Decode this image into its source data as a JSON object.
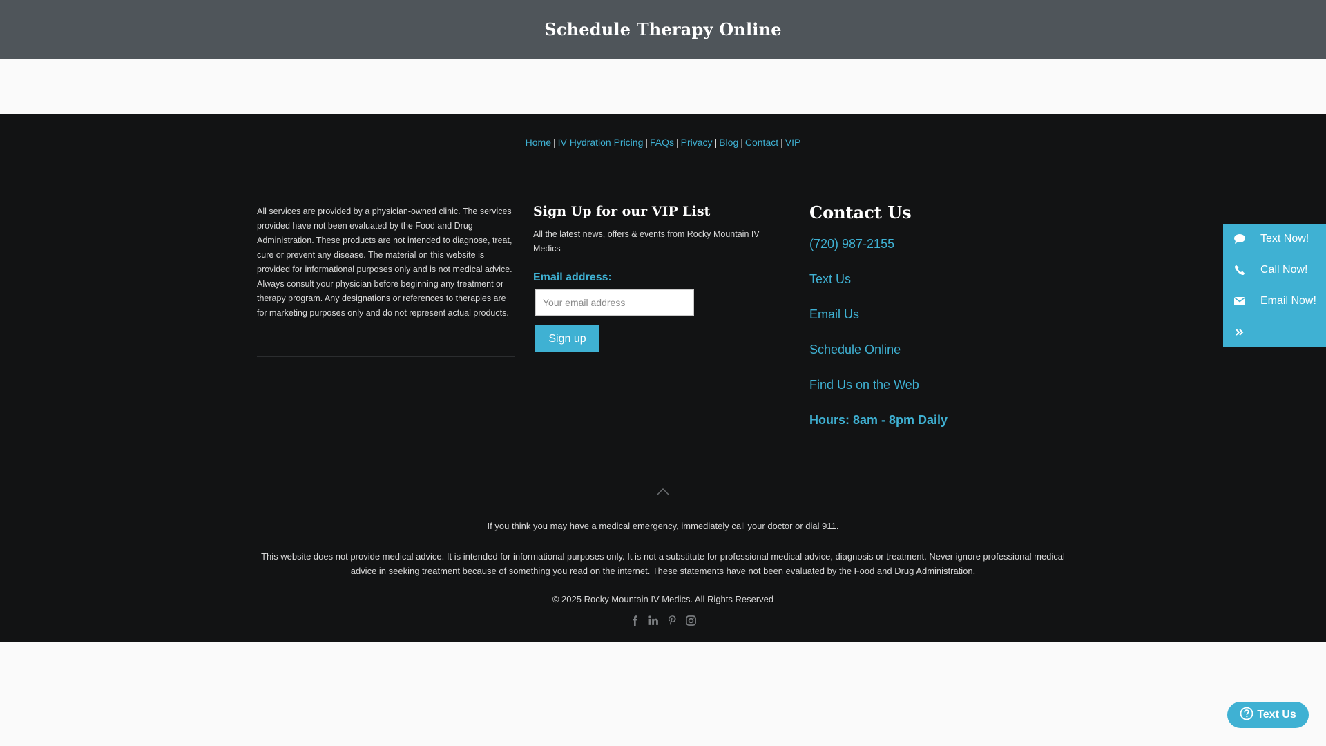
{
  "header": {
    "title": "Schedule Therapy Online"
  },
  "footer_nav": {
    "items": [
      {
        "label": "Home"
      },
      {
        "label": "IV Hydration Pricing"
      },
      {
        "label": "FAQs"
      },
      {
        "label": "Privacy"
      },
      {
        "label": "Blog"
      },
      {
        "label": "Contact"
      },
      {
        "label": "VIP"
      }
    ],
    "separator": "|"
  },
  "disclaimer_column": {
    "text": "All services are provided by a physician-owned clinic. The services provided have not been evaluated by the Food and Drug Administration. These products are not intended to diagnose, treat, cure or prevent any disease. The material on this website is provided for informational purposes only and is not medical advice. Always consult your physician before beginning any treatment or therapy program. Any designations or references to therapies are for marketing purposes only and do not represent actual products."
  },
  "vip_signup": {
    "heading": "Sign Up for our VIP List",
    "description": "All the latest news, offers & events from Rocky Mountain IV Medics",
    "email_label": "Email address:",
    "email_placeholder": "Your email address",
    "email_value": "",
    "button_label": "Sign up"
  },
  "contact": {
    "heading": "Contact Us",
    "phone": "(720) 987-2155",
    "text_us": "Text Us",
    "email_us": "Email Us",
    "schedule_online": "Schedule Online",
    "find_us": "Find Us on the Web",
    "hours": "Hours: 8am - 8pm Daily"
  },
  "bottom": {
    "emergency": "If you think you may have a medical emergency, immediately call your doctor or dial 911.",
    "disclaimer": "This website does not provide medical advice. It is intended for informational purposes only. It is not a substitute for professional medical advice, diagnosis or treatment. Never ignore professional medical advice in seeking treatment because of something you read on the internet. These statements have not been evaluated by the Food and Drug Administration.",
    "copyright": "© 2025 Rocky Mountain IV Medics. All Rights Reserved",
    "social_icons": [
      "facebook-icon",
      "linkedin-icon",
      "pinterest-icon",
      "instagram-icon"
    ]
  },
  "side_panel": {
    "items": [
      {
        "label": "Text Now!",
        "icon": "chat-bubble-icon"
      },
      {
        "label": "Call Now!",
        "icon": "phone-icon"
      },
      {
        "label": "Email Now!",
        "icon": "envelope-icon"
      }
    ],
    "collapse_icon": "double-chevron-right-icon"
  },
  "chat_button": {
    "label": "Text Us",
    "icon": "question-circle-icon"
  },
  "colors": {
    "accent": "#3fb1d3",
    "header_bg": "#4f555a",
    "footer_bg": "#121314",
    "page_bg": "#fafafa"
  }
}
